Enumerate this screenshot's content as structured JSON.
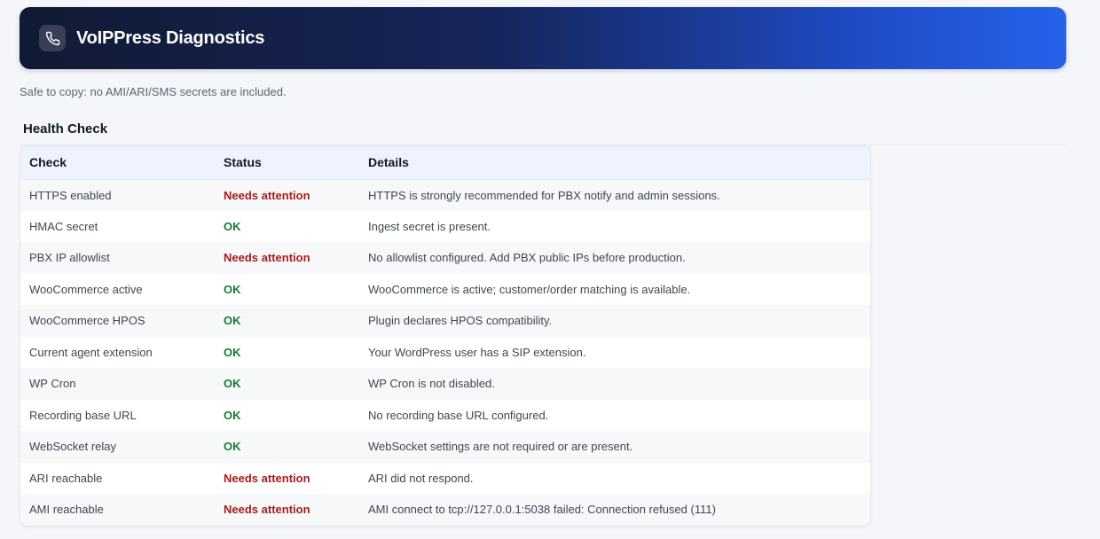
{
  "header": {
    "title": "VoIPPress Diagnostics",
    "icon": "phone-icon"
  },
  "note": "Safe to copy: no AMI/ARI/SMS secrets are included.",
  "health": {
    "title": "Health Check",
    "columns": [
      "Check",
      "Status",
      "Details"
    ],
    "rows": [
      {
        "check": "HTTPS enabled",
        "status": "Needs attention",
        "state": "warn",
        "details": "HTTPS is strongly recommended for PBX notify and admin sessions."
      },
      {
        "check": "HMAC secret",
        "status": "OK",
        "state": "ok",
        "details": "Ingest secret is present."
      },
      {
        "check": "PBX IP allowlist",
        "status": "Needs attention",
        "state": "warn",
        "details": "No allowlist configured. Add PBX public IPs before production."
      },
      {
        "check": "WooCommerce active",
        "status": "OK",
        "state": "ok",
        "details": "WooCommerce is active; customer/order matching is available."
      },
      {
        "check": "WooCommerce HPOS",
        "status": "OK",
        "state": "ok",
        "details": "Plugin declares HPOS compatibility."
      },
      {
        "check": "Current agent extension",
        "status": "OK",
        "state": "ok",
        "details": "Your WordPress user has a SIP extension."
      },
      {
        "check": "WP Cron",
        "status": "OK",
        "state": "ok",
        "details": "WP Cron is not disabled."
      },
      {
        "check": "Recording base URL",
        "status": "OK",
        "state": "ok",
        "details": "No recording base URL configured."
      },
      {
        "check": "WebSocket relay",
        "status": "OK",
        "state": "ok",
        "details": "WebSocket settings are not required or are present."
      },
      {
        "check": "ARI reachable",
        "status": "Needs attention",
        "state": "warn",
        "details": "ARI did not respond."
      },
      {
        "check": "AMI reachable",
        "status": "Needs attention",
        "state": "warn",
        "details": "AMI connect to tcp://127.0.0.1:5038 failed: Connection refused (111)"
      }
    ]
  },
  "colors": {
    "ok": "#177a32",
    "warn": "#a61c1c",
    "header_start": "#111a33",
    "header_end": "#2563eb"
  }
}
